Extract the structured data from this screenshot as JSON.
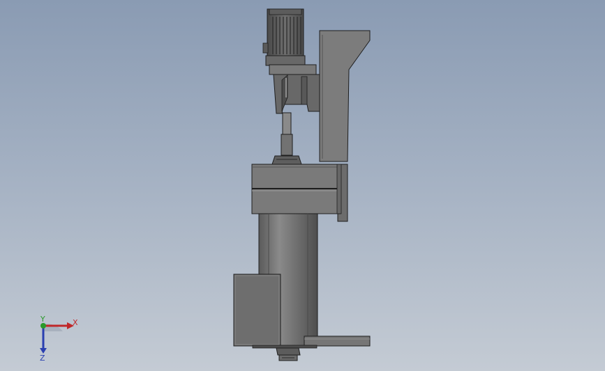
{
  "viewport": {
    "background_top": "#8a9bb3",
    "background_bottom": "#c4cbd4"
  },
  "model": {
    "body_color": "#707070",
    "highlight_color": "#8a8a8a",
    "edge_color": "#1e1e1e",
    "parts": [
      "motor",
      "gearbox",
      "coupling-shaft",
      "bearing-housing",
      "support-bracket",
      "column",
      "side-box",
      "base-plate",
      "impeller"
    ]
  },
  "triad": {
    "x_label": "X",
    "y_label": "Y",
    "z_label": "Z",
    "x_color": "#c0282a",
    "y_color": "#2a9a2a",
    "z_color": "#2a3fb0",
    "icon": "coordinate-triad-icon"
  }
}
